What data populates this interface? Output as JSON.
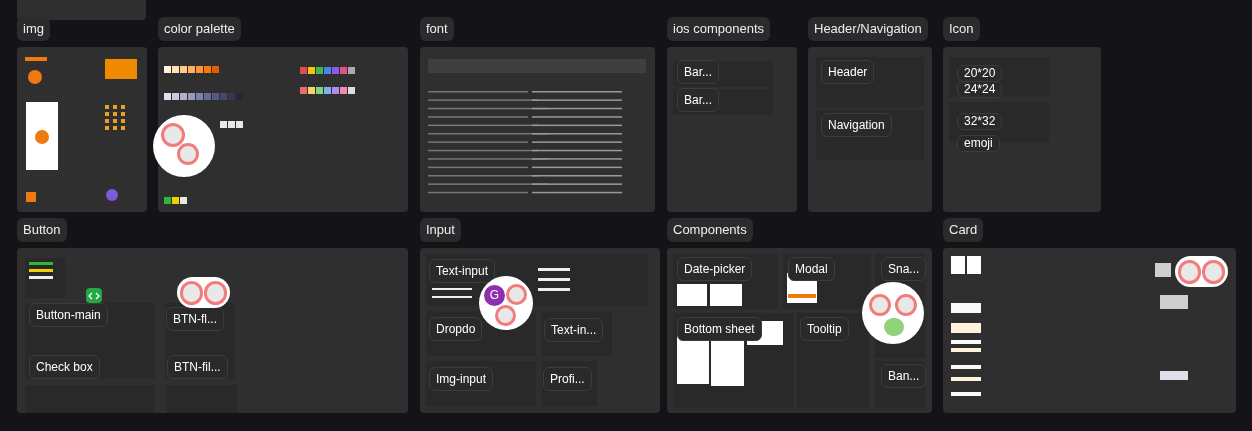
{
  "canvas": {
    "frames": [
      {
        "title": "img"
      },
      {
        "title": "color palette"
      },
      {
        "title": "font"
      },
      {
        "title": "ios components",
        "sections": [
          "Bar...",
          "Bar..."
        ]
      },
      {
        "title": "Header/Navigation",
        "sections": [
          "Header",
          "Navigation"
        ]
      },
      {
        "title": "Icon",
        "sections": [
          "20*20",
          "24*24",
          "32*32",
          "emoji"
        ]
      },
      {
        "title": "Button",
        "sections": [
          "Button-main",
          "Check box",
          "BTN-fl...",
          "BTN-fil..."
        ]
      },
      {
        "title": "Input",
        "sections": [
          "Text-input",
          "Dropdo",
          "Text-in...",
          "Img-input",
          "Profi..."
        ]
      },
      {
        "title": "Components",
        "sections": [
          "Date-picker",
          "Modal",
          "Sna...",
          "Bottom sheet",
          "Tooltip",
          "Ban..."
        ]
      },
      {
        "title": "Card"
      }
    ]
  },
  "collaborator": {
    "initial": "G"
  }
}
